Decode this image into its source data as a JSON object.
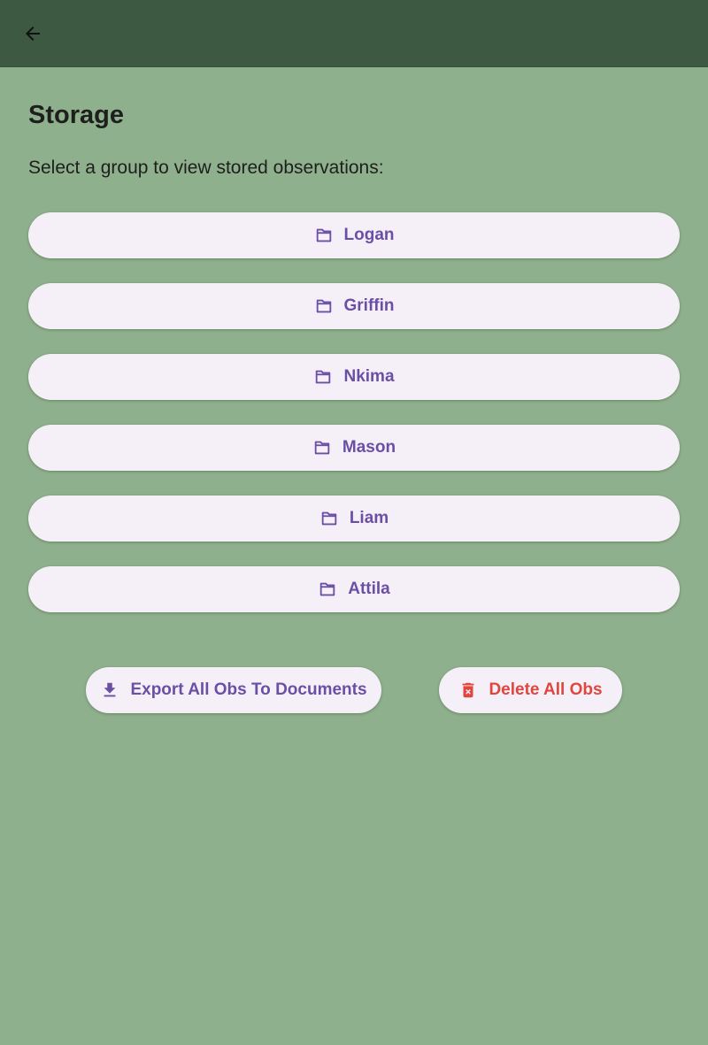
{
  "appbar": {
    "back_icon": "arrow-left-icon"
  },
  "page": {
    "title": "Storage",
    "subtitle": "Select a group to view stored observations:"
  },
  "groups": [
    {
      "label": "Logan",
      "icon": "folder-icon"
    },
    {
      "label": "Griffin",
      "icon": "folder-icon"
    },
    {
      "label": "Nkima",
      "icon": "folder-icon"
    },
    {
      "label": "Mason",
      "icon": "folder-icon"
    },
    {
      "label": "Liam",
      "icon": "folder-icon"
    },
    {
      "label": "Attila",
      "icon": "folder-icon"
    }
  ],
  "actions": {
    "export_label": "Export All Obs To Documents",
    "export_icon": "download-icon",
    "delete_label": "Delete All Obs",
    "delete_icon": "trash-icon"
  },
  "colors": {
    "background": "#8fb08c",
    "appbar": "#3d5941",
    "button_bg": "#f5f0f8",
    "primary_text": "#6b4fa5",
    "danger_text": "#e0463d"
  }
}
